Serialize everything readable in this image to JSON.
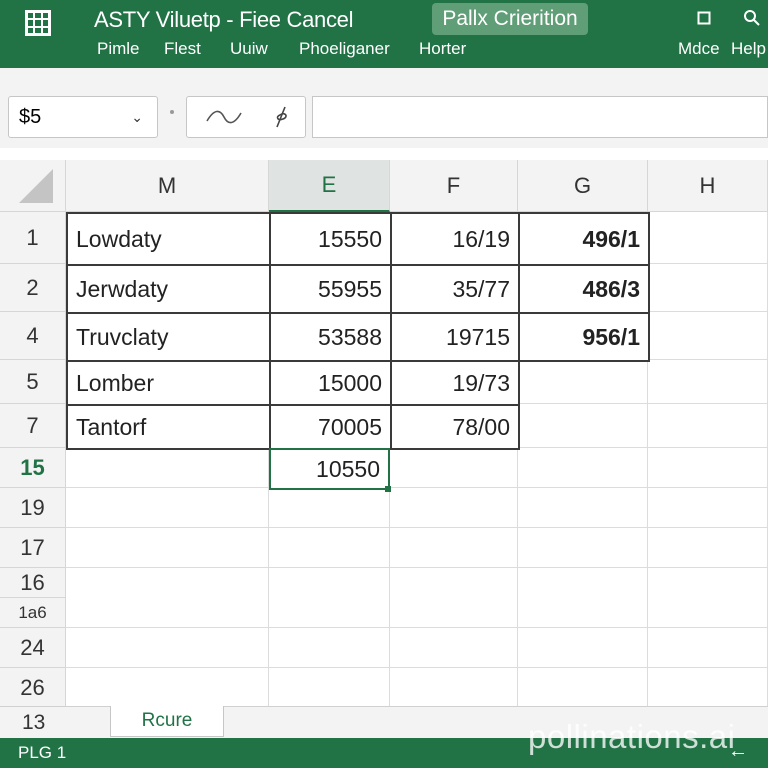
{
  "ribbon": {
    "title": "ASTY Viluetp - Fiee Cancel",
    "search_label": "Pallx Crierition",
    "window_icons": [
      "restore-icon",
      "close-icon"
    ],
    "menu": [
      "Pimle",
      "Flest",
      "Uuiw",
      "Phoeliganer",
      "Horter",
      "Mdce",
      "Help"
    ]
  },
  "toolbar": {
    "name_box": "$5"
  },
  "sheet": {
    "columns": [
      "M",
      "E",
      "F",
      "G",
      "H"
    ],
    "selected_column": "E",
    "row_headers": [
      "1",
      "2",
      "4",
      "5",
      "7",
      "15",
      "19",
      "17",
      "16",
      "1a6",
      "24",
      "26"
    ],
    "selected_row": "15",
    "rows": [
      [
        "Lowdaty",
        "15550",
        "16/19",
        "496/1",
        ""
      ],
      [
        "Jerwdaty",
        "55955",
        "35/77",
        "486/3",
        ""
      ],
      [
        "Truvclaty",
        "53588",
        "19715",
        "956/1",
        ""
      ],
      [
        "Lomber",
        "15000",
        "19/73",
        "",
        ""
      ],
      [
        "Tantorf",
        "70005",
        "78/00",
        "",
        ""
      ],
      [
        "",
        "10550",
        "",
        "",
        ""
      ]
    ]
  },
  "sheet_bar": {
    "row_number": "13",
    "tab_label": "Rcure"
  },
  "status": {
    "left_text": "PLG 1",
    "right_icon": "arrow-left-icon"
  },
  "watermark": "pollinations.ai",
  "colors": {
    "accent": "#217346",
    "header_bg": "#f3f3f3",
    "grid_line": "#dcdcdc"
  }
}
